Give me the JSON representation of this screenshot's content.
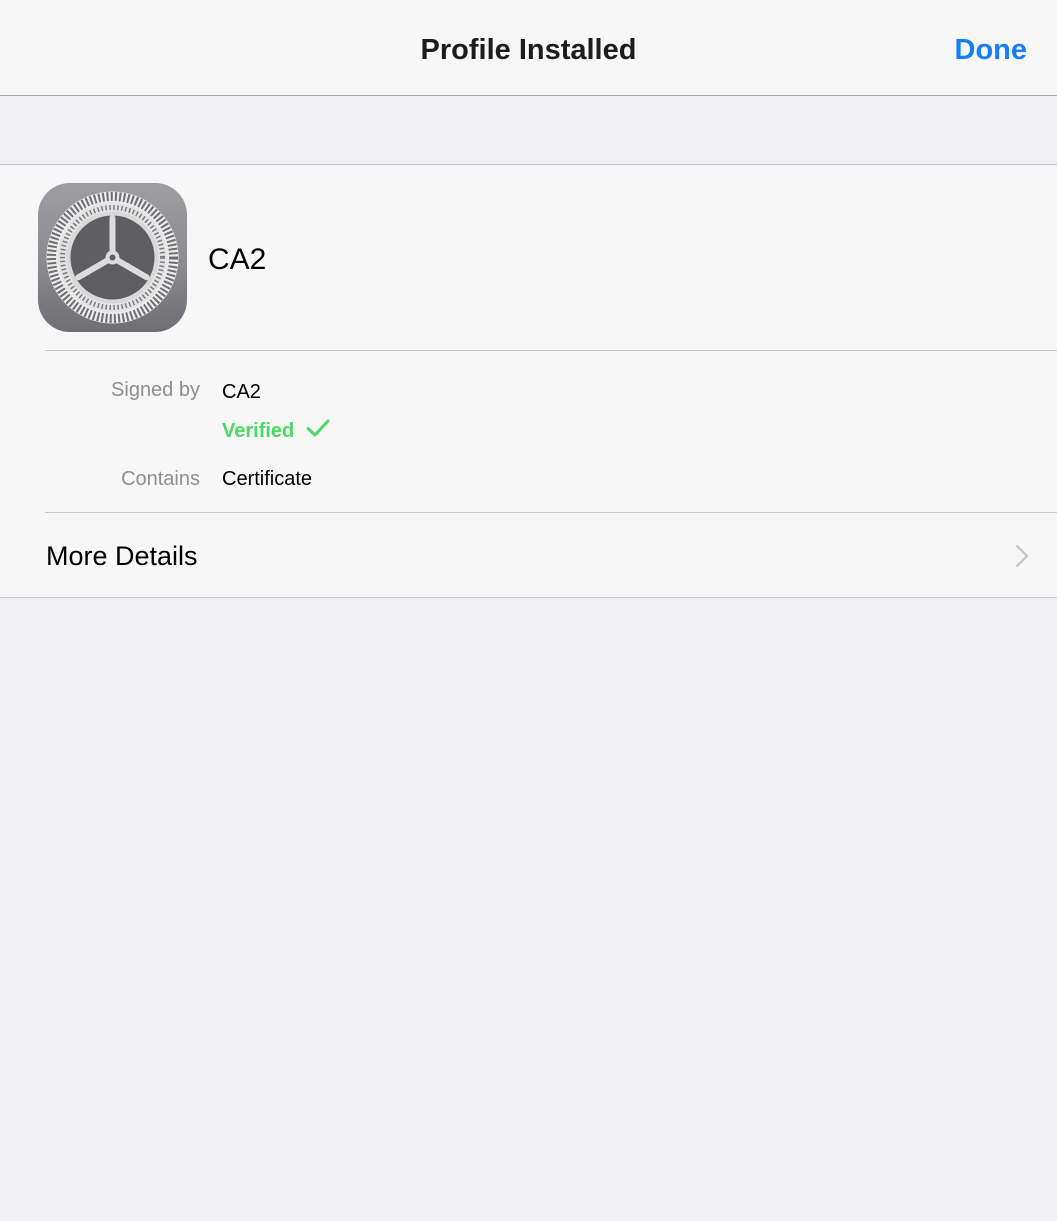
{
  "navbar": {
    "title": "Profile Installed",
    "done_label": "Done"
  },
  "profile": {
    "name": "CA2",
    "icon": "settings-gear-icon",
    "signed_by_label": "Signed by",
    "signed_by_value": "CA2",
    "verified_label": "Verified",
    "contains_label": "Contains",
    "contains_value": "Certificate",
    "more_details_label": "More Details"
  },
  "colors": {
    "accent": "#147efb",
    "verified": "#4cd964",
    "background": "#efeff4",
    "card": "#f7f7f7",
    "separator": "#c8c7cc",
    "label_gray": "#8e8e93"
  }
}
